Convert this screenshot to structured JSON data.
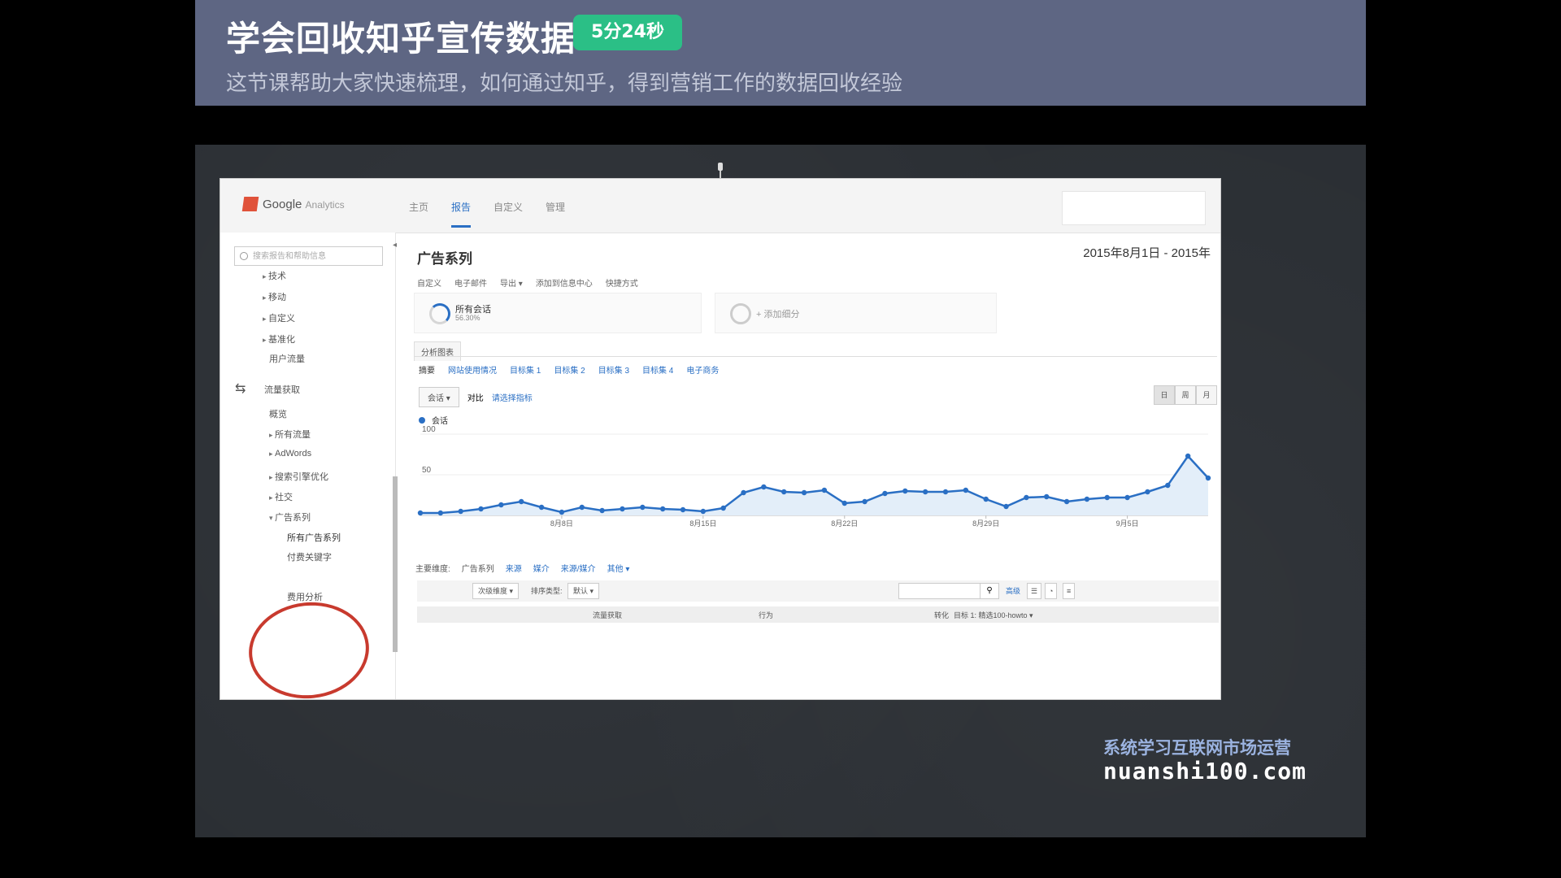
{
  "banner": {
    "title": "学会回收知乎宣传数据",
    "duration_badge": "5分24秒",
    "subtitle": "这节课帮助大家快速梳理，如何通过知乎，得到营销工作的数据回收经验"
  },
  "ga": {
    "logo_brand": "Google",
    "logo_product": "Analytics",
    "nav": [
      "主页",
      "报告",
      "自定义",
      "管理"
    ],
    "sidebar": {
      "search_placeholder": "搜索报告和帮助信息",
      "items_top": [
        "技术",
        "移动",
        "自定义",
        "基准化"
      ],
      "user_flow": "用户流量",
      "section_label": "流量获取",
      "overview": "概览",
      "items_mid": [
        "所有流量",
        "AdWords",
        "搜索引擎优化"
      ],
      "social_partial": "社交",
      "campaigns": "广告系列",
      "campaign_children": [
        "所有广告系列",
        "付费关键字"
      ],
      "cost_analysis": "费用分析"
    },
    "page_title": "广告系列",
    "date_range": "2015年8月1日 - 2015年",
    "toolbar": [
      "自定义",
      "电子邮件",
      "导出 ▾",
      "添加到信息中心",
      "快捷方式"
    ],
    "segments": {
      "all_sessions_label": "所有会话",
      "all_sessions_pct": "56.30%",
      "add_segment": "+ 添加细分"
    },
    "explorer_tab": "分析图表",
    "subtabs": [
      "摘要",
      "网站使用情况",
      "目标集 1",
      "目标集 2",
      "目标集 3",
      "目标集 4",
      "电子商务"
    ],
    "metric_select": "会话",
    "compare_label": "对比",
    "compare_link": "请选择指标",
    "view_buttons": [
      "日",
      "周",
      "月"
    ],
    "legend_label": "会话",
    "dimension_bar": [
      "主要维度:",
      "广告系列",
      "来源",
      "媒介",
      "来源/媒介",
      "其他 ▾"
    ],
    "table_ctrls": {
      "secondary": "次级维度 ▾",
      "sort_label": "排序类型:",
      "sort_value": "默认 ▾",
      "advanced": "高级"
    },
    "table_head": [
      "流量获取",
      "行为",
      "转化",
      "目标 1: 精选100-howto ▾"
    ]
  },
  "chart_data": {
    "type": "line",
    "title": "",
    "ylabel": "",
    "ylim": [
      0,
      100
    ],
    "y_ticks": [
      50,
      100
    ],
    "x_tick_labels": [
      "8月8日",
      "8月15日",
      "8月22日",
      "8月29日",
      "9月5日"
    ],
    "x_tick_indices": [
      7,
      14,
      21,
      28,
      35
    ],
    "series": [
      {
        "name": "会话",
        "color": "#2a6fc4",
        "values": [
          3,
          3,
          5,
          8,
          13,
          17,
          10,
          4,
          10,
          6,
          8,
          10,
          8,
          7,
          5,
          9,
          28,
          35,
          29,
          28,
          31,
          15,
          17,
          27,
          30,
          29,
          29,
          31,
          20,
          11,
          22,
          23,
          17,
          20,
          22,
          22,
          29,
          37,
          73,
          46
        ]
      }
    ]
  },
  "watermark": {
    "line1": "系统学习互联网市场运营",
    "line2": "nuanshi100.com"
  }
}
